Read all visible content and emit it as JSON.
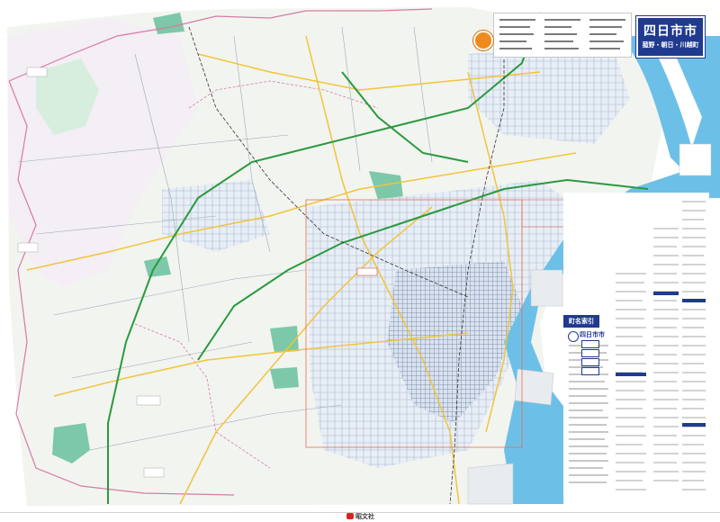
{
  "map": {
    "title": "四日市市",
    "subtitle": "菰野・朝日・川越町",
    "index_title": "町名索引",
    "index_city": "四日市市",
    "publisher": "昭文社"
  },
  "colors": {
    "sea": "#6cc0e8",
    "land": "#f2f4f0",
    "land_tint": "#f4eef5",
    "forest": "#bfe6cf",
    "park": "#6fbfa0",
    "outer_area": "#ffffff",
    "boundary": "#d77aa6",
    "highway": "#2a9a3e",
    "road_major": "#f2c43a",
    "road_minor": "#9aa9b5",
    "brand_blue": "#1f3a8f",
    "accent_orange": "#f08a1d"
  }
}
